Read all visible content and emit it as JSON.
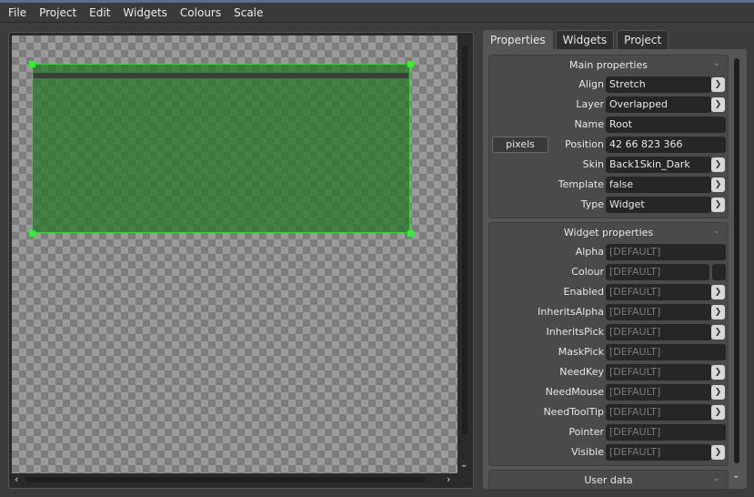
{
  "menu": [
    "File",
    "Project",
    "Edit",
    "Widgets",
    "Colours",
    "Scale"
  ],
  "tabs": [
    {
      "label": "Properties",
      "active": true
    },
    {
      "label": "Widgets",
      "active": false
    },
    {
      "label": "Project",
      "active": false
    }
  ],
  "main_properties": {
    "title": "Main properties",
    "pixels_button": "pixels",
    "rows": [
      {
        "label": "Align",
        "value": "Stretch",
        "type": "combo"
      },
      {
        "label": "Layer",
        "value": "Overlapped",
        "type": "combo"
      },
      {
        "label": "Name",
        "value": "Root",
        "type": "text"
      },
      {
        "label": "Position",
        "value": "42 66 823 366",
        "type": "text"
      },
      {
        "label": "Skin",
        "value": "Back1Skin_Dark",
        "type": "combo"
      },
      {
        "label": "Template",
        "value": "false",
        "type": "combo"
      },
      {
        "label": "Type",
        "value": "Widget",
        "type": "combo"
      }
    ]
  },
  "widget_properties": {
    "title": "Widget properties",
    "rows": [
      {
        "label": "Alpha",
        "value": "[DEFAULT]",
        "type": "text"
      },
      {
        "label": "Colour",
        "value": "[DEFAULT]",
        "type": "colour"
      },
      {
        "label": "Enabled",
        "value": "[DEFAULT]",
        "type": "combo"
      },
      {
        "label": "InheritsAlpha",
        "value": "[DEFAULT]",
        "type": "combo"
      },
      {
        "label": "InheritsPick",
        "value": "[DEFAULT]",
        "type": "combo"
      },
      {
        "label": "MaskPick",
        "value": "[DEFAULT]",
        "type": "text"
      },
      {
        "label": "NeedKey",
        "value": "[DEFAULT]",
        "type": "combo"
      },
      {
        "label": "NeedMouse",
        "value": "[DEFAULT]",
        "type": "combo"
      },
      {
        "label": "NeedToolTip",
        "value": "[DEFAULT]",
        "type": "combo"
      },
      {
        "label": "Pointer",
        "value": "[DEFAULT]",
        "type": "text"
      },
      {
        "label": "Visible",
        "value": "[DEFAULT]",
        "type": "combo"
      }
    ]
  },
  "user_data": {
    "title": "User data"
  },
  "icons": {
    "dropdown": "chevron-down-icon",
    "collapse": "chevron-down-icon",
    "scroll_down": "arrow-down-icon",
    "scroll_left": "arrow-left-icon",
    "scroll_right": "arrow-right-icon"
  },
  "colors": {
    "widget_fill": "#287828",
    "widget_border": "#3ad13a",
    "handle": "#33ee33",
    "active_tab": "#555555"
  }
}
